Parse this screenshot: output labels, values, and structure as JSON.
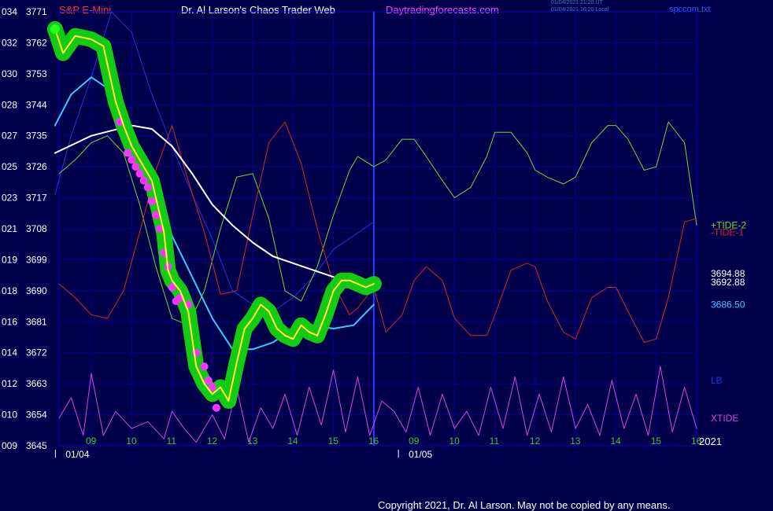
{
  "header": {
    "symbol": "S&P E-Mini",
    "title": "Dr. Al Larson's Chaos Trader Web",
    "site": "Daytradingforecasts.com",
    "timestamp_1": "01/04/2021 21:20 UT",
    "timestamp_2": "01/04/2021 16:20 Local",
    "filename": "spccom.txt"
  },
  "footer": {
    "copyright": "Copyright 2021, Dr. Al Larson. May not be copied by any means."
  },
  "colors": {
    "background": "#00004a",
    "grid": "#0000c8",
    "price": "#ffff33",
    "price_glow": "#11cc11",
    "raw": "#ff00ff",
    "dots": "#ff33ff",
    "cyan_ma": "#33ccff",
    "white_ma": "#ffffff",
    "tide2": "#66dd33",
    "tide1": "#dd2222",
    "lb": "#1a3ad8",
    "xtide": "#dd44dd"
  },
  "chart_data": {
    "type": "line",
    "left_axis_labels": [
      "034",
      "032",
      "030",
      "028",
      "027",
      "025",
      "023",
      "021",
      "019",
      "018",
      "016",
      "014",
      "012",
      "010",
      "009"
    ],
    "right_axis_labels": [
      "3771",
      "3762",
      "3753",
      "3744",
      "3735",
      "3726",
      "3717",
      "3708",
      "3699",
      "3690",
      "3681",
      "3672",
      "3663",
      "3654",
      "3645"
    ],
    "ylim": [
      3645,
      3771
    ],
    "x_tick_labels": [
      "09",
      "10",
      "11",
      "12",
      "13",
      "14",
      "15",
      "16",
      "09",
      "10",
      "11",
      "12",
      "13",
      "14",
      "15",
      "16"
    ],
    "x_tick_hours": [
      9,
      10,
      11,
      12,
      13,
      14,
      15,
      16,
      17,
      18,
      19,
      20,
      21,
      22,
      23,
      24
    ],
    "xlim": [
      8.2,
      24
    ],
    "date_labels": [
      {
        "text": "01/04",
        "hour": 8.5
      },
      {
        "text": "01/05",
        "hour": 17
      }
    ],
    "year_label": "2021",
    "now_hour": 16,
    "right_labels": [
      {
        "text": "+TIDE-2",
        "value": 3709,
        "color": "#66dd33"
      },
      {
        "text": "-TIDE-1",
        "value": 3707,
        "color": "#dd2222"
      },
      {
        "text": "3694.88",
        "value": 3695,
        "color": "#ffffff"
      },
      {
        "text": "3692.88",
        "value": 3692.5,
        "color": "#ffffff"
      },
      {
        "text": "3686.50",
        "value": 3686,
        "color": "#33ccff"
      },
      {
        "text": "LB",
        "value": 3664,
        "color": "#1a3ad8"
      },
      {
        "text": "XTIDE",
        "value": 3653,
        "color": "#dd44dd"
      }
    ],
    "series": [
      {
        "name": "price",
        "x": [
          8.1,
          8.3,
          8.6,
          9,
          9.3,
          9.6,
          9.8,
          10,
          10.2,
          10.5,
          10.8,
          10.9,
          11,
          11.2,
          11.4,
          11.6,
          11.8,
          12,
          12.2,
          12.4,
          12.6,
          12.8,
          13,
          13.2,
          13.4,
          13.6,
          13.8,
          14,
          14.2,
          14.4,
          14.6,
          14.8,
          15,
          15.2,
          15.4,
          15.6,
          15.8,
          16
        ],
        "y": [
          3766,
          3759,
          3764,
          3763,
          3761,
          3745,
          3738,
          3732,
          3728,
          3722,
          3707,
          3696,
          3693,
          3690,
          3684,
          3668,
          3663,
          3660,
          3662,
          3658,
          3669,
          3679,
          3682,
          3686,
          3684,
          3679,
          3677,
          3676,
          3680,
          3678,
          3677,
          3683,
          3690,
          3693,
          3693,
          3692,
          3691,
          3692
        ]
      },
      {
        "name": "+TIDE-2",
        "x": [
          8.2,
          8.6,
          9,
          9.4,
          9.8,
          10.2,
          10.6,
          11,
          11.4,
          11.8,
          12.2,
          12.6,
          13,
          13.4,
          13.8,
          14.2,
          14.6,
          15,
          15.4,
          15.6,
          16,
          16.3,
          16.7,
          17,
          17.3,
          17.7,
          18,
          18.4,
          18.8,
          19,
          19.4,
          19.8,
          20,
          20.3,
          20.7,
          21,
          21.4,
          21.8,
          22,
          22.3,
          22.7,
          23,
          23.3,
          23.7,
          24
        ],
        "y": [
          3724,
          3728,
          3733,
          3735,
          3730,
          3715,
          3697,
          3682,
          3680,
          3690,
          3708,
          3723,
          3724,
          3711,
          3690,
          3687,
          3697,
          3712,
          3725,
          3729,
          3726,
          3728,
          3734,
          3734,
          3729,
          3722,
          3717,
          3720,
          3729,
          3736,
          3736,
          3730,
          3725,
          3723,
          3721,
          3723,
          3733,
          3738,
          3738,
          3734,
          3725,
          3726,
          3739,
          3733,
          3709
        ]
      },
      {
        "name": "-TIDE-1",
        "x": [
          8.2,
          8.6,
          9,
          9.4,
          9.8,
          10.2,
          10.6,
          11,
          11.4,
          11.8,
          12.2,
          12.6,
          13,
          13.4,
          13.8,
          14.2,
          14.6,
          15,
          15.4,
          15.6,
          16,
          16.3,
          16.7,
          17,
          17.3,
          17.7,
          18,
          18.4,
          18.8,
          19,
          19.4,
          19.8,
          20,
          20.3,
          20.7,
          21,
          21.4,
          21.8,
          22,
          22.3,
          22.7,
          23,
          23.3,
          23.7,
          24
        ],
        "y": [
          3692,
          3688,
          3683,
          3682,
          3690,
          3707,
          3725,
          3738,
          3722,
          3707,
          3689,
          3690,
          3712,
          3733,
          3739,
          3727,
          3708,
          3692,
          3683,
          3685,
          3691,
          3678,
          3683,
          3693,
          3697,
          3693,
          3682,
          3677,
          3677,
          3683,
          3696,
          3698,
          3697,
          3687,
          3678,
          3676,
          3688,
          3691,
          3691,
          3684,
          3675,
          3676,
          3688,
          3710,
          3711
        ]
      },
      {
        "name": "cyan",
        "x": [
          8.1,
          8.5,
          9,
          9.5,
          10,
          10.5,
          11,
          11.5,
          12,
          12.5,
          13,
          13.5,
          14,
          14.5,
          15,
          15.5,
          16
        ],
        "y": [
          3738,
          3747,
          3752,
          3748,
          3736,
          3721,
          3706,
          3694,
          3682,
          3673,
          3673,
          3675,
          3679,
          3680,
          3679,
          3680,
          3686
        ]
      },
      {
        "name": "white",
        "x": [
          8.1,
          9,
          10,
          10.5,
          11,
          11.5,
          12,
          12.5,
          13,
          13.5,
          14,
          14.5,
          15,
          15.5,
          16
        ],
        "y": [
          3730,
          3735,
          3738,
          3737,
          3732,
          3724,
          3715,
          3709,
          3704,
          3700,
          3698,
          3696,
          3694,
          3693,
          3693
        ]
      },
      {
        "name": "LB",
        "x": [
          8.1,
          8.5,
          9,
          9.5,
          10,
          10.5,
          11,
          11.5,
          12,
          12.5,
          13,
          13.5,
          14,
          14.5,
          15,
          15.5,
          16
        ],
        "y": [
          3718,
          3735,
          3752,
          3776,
          3765,
          3747,
          3732,
          3718,
          3705,
          3690,
          3686,
          3684,
          3688,
          3694,
          3702,
          3706,
          3710
        ]
      },
      {
        "name": "XTIDE",
        "x": [
          8.2,
          8.5,
          8.8,
          9,
          9.3,
          9.6,
          10,
          10.4,
          10.8,
          11,
          11.3,
          11.6,
          12,
          12.3,
          12.6,
          12.9,
          13.2,
          13.5,
          13.8,
          14.1,
          14.4,
          14.7,
          15,
          15.3,
          15.6,
          15.9,
          16.2,
          16.5,
          16.8,
          17.1,
          17.4,
          17.7,
          18,
          18.3,
          18.6,
          18.9,
          19.2,
          19.5,
          19.8,
          20.1,
          20.4,
          20.7,
          21,
          21.3,
          21.6,
          21.9,
          22.2,
          22.5,
          22.8,
          23.1,
          23.4,
          23.7,
          24
        ],
        "y": [
          3653,
          3659,
          3648,
          3666,
          3648,
          3655,
          3650,
          3652,
          3647,
          3655,
          3650,
          3646,
          3654,
          3647,
          3662,
          3646,
          3656,
          3650,
          3660,
          3648,
          3662,
          3651,
          3667,
          3649,
          3665,
          3648,
          3658,
          3655,
          3649,
          3662,
          3648,
          3660,
          3650,
          3655,
          3648,
          3662,
          3650,
          3665,
          3648,
          3660,
          3649,
          3665,
          3650,
          3657,
          3648,
          3664,
          3650,
          3660,
          3648,
          3668,
          3649,
          3662,
          3650
        ]
      }
    ],
    "dots": {
      "name": "dots",
      "x": [
        9.7,
        9.9,
        10,
        10.1,
        10.2,
        10.3,
        10.4,
        10.5,
        10.6,
        10.7,
        10.8,
        10.9,
        11,
        11.1,
        11.2,
        11.4,
        11.6,
        11.8,
        11.9,
        12,
        12.1
      ],
      "y": [
        3739,
        3730,
        3728,
        3726,
        3724,
        3722,
        3720,
        3716,
        3712,
        3708,
        3701,
        3697,
        3691,
        3687,
        3688,
        3686,
        3672,
        3668,
        3664,
        3662,
        3656
      ]
    }
  }
}
